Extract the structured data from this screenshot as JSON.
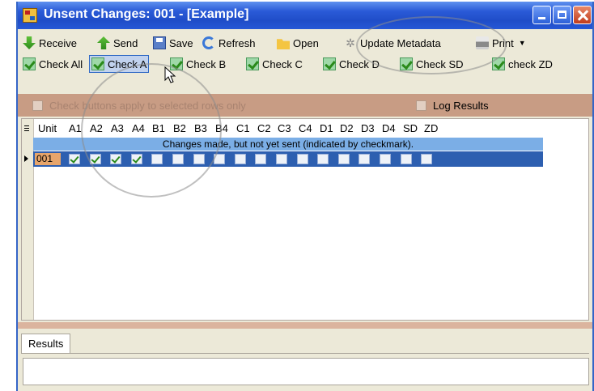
{
  "window": {
    "title": "Unsent Changes: 001 - [Example]"
  },
  "toolbar": {
    "receive": "Receive",
    "send": "Send",
    "save": "Save",
    "refresh": "Refresh",
    "open": "Open",
    "update_metadata": "Update Metadata",
    "print": "Print"
  },
  "check_toolbar": {
    "check_all": "Check All",
    "check_a": "Check A",
    "check_b": "Check B",
    "check_c": "Check C",
    "check_d": "Check D",
    "check_sd": "Check SD",
    "check_zd": "check ZD"
  },
  "options": {
    "selected_rows_only": "Check buttons apply to selected rows only",
    "log_results": "Log Results"
  },
  "grid": {
    "columns": [
      "Unit",
      "A1",
      "A2",
      "A3",
      "A4",
      "B1",
      "B2",
      "B3",
      "B4",
      "C1",
      "C2",
      "C3",
      "C4",
      "D1",
      "D2",
      "D3",
      "D4",
      "SD",
      "ZD"
    ],
    "banner": "Changes made, but not yet sent (indicated by checkmark).",
    "row": {
      "unit": "001",
      "checks": [
        true,
        true,
        true,
        true,
        false,
        false,
        false,
        false,
        false,
        false,
        false,
        false,
        false,
        false,
        false,
        false,
        false,
        false
      ]
    }
  },
  "results": {
    "tab_label": "Results"
  }
}
